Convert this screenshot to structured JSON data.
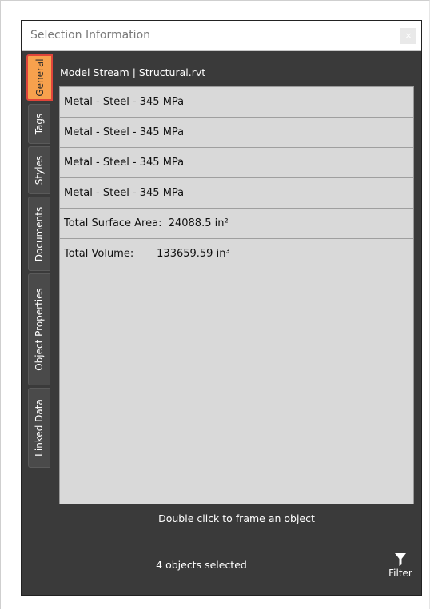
{
  "window": {
    "title": "Selection Information",
    "close_label": "×"
  },
  "tabs": [
    {
      "label": "General",
      "active": true
    },
    {
      "label": "Tags",
      "active": false
    },
    {
      "label": "Styles",
      "active": false
    },
    {
      "label": "Documents",
      "active": false
    },
    {
      "label": "Object Properties",
      "active": false
    },
    {
      "label": "Linked Data",
      "active": false
    }
  ],
  "stream": {
    "title": "Model Stream | Structural.rvt"
  },
  "items": [
    "Metal - Steel - 345 MPa",
    "Metal - Steel - 345 MPa",
    "Metal - Steel - 345 MPa",
    "Metal - Steel - 345 MPa",
    "Total Surface Area:  24088.5 in²",
    "Total Volume:       133659.59 in³"
  ],
  "footer": {
    "hint": "Double click to frame an object",
    "count": "4 objects selected",
    "filter_label": "Filter"
  },
  "colors": {
    "panel_bg": "#3a3a3a",
    "active_tab": "#f7a14d",
    "active_tab_border": "#e0453a",
    "list_bg": "#d9d9d9"
  },
  "icons": {
    "filter": "filter-funnel-icon",
    "close": "close-icon"
  }
}
